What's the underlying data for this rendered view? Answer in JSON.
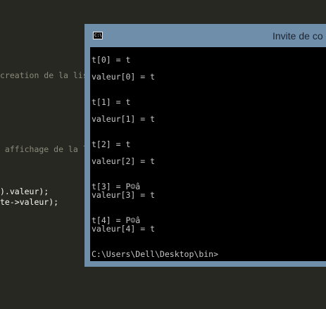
{
  "editor": {
    "lines": [
      {
        "text": "creation de la lis",
        "kind": "comment"
      },
      {
        "text": " affichage de la l",
        "kind": "comment"
      },
      {
        "text": ").valeur);",
        "kind": "plain"
      },
      {
        "text": "te->valeur);",
        "kind": "plain"
      }
    ]
  },
  "window": {
    "title": "Invite de co",
    "icon_label": "C:\\",
    "console_lines": [
      "t[0] = t",
      "valeur[0] = t",
      "t[1] = t",
      "valeur[1] = t",
      "t[2] = t",
      "valeur[2] = t",
      "t[3] = P☺â",
      "valeur[3] = t",
      "t[4] = P☺â",
      "valeur[4] = t",
      "C:\\Users\\Dell\\Desktop\\bin>"
    ]
  },
  "colors": {
    "editor_background": "#272822",
    "titlebar": "#6f8ea9",
    "console_background": "#000000",
    "console_text": "#c6c6c6"
  }
}
